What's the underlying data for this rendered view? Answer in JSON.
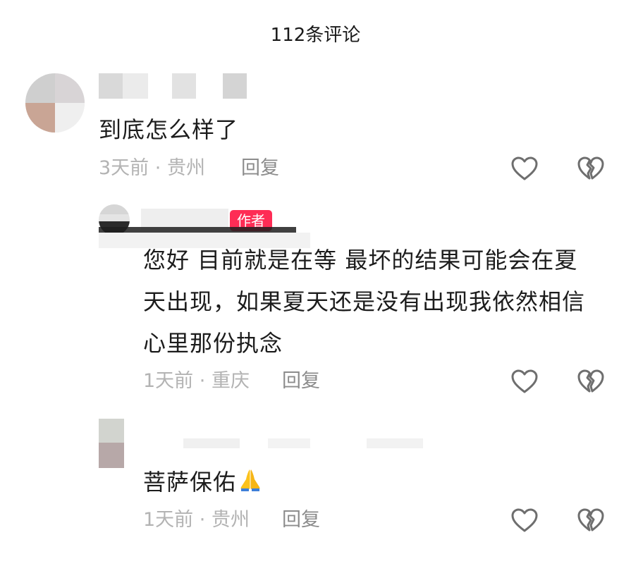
{
  "header": {
    "title": "112条评论"
  },
  "comments": [
    {
      "text": "到底怎么样了",
      "time": "3天前",
      "location": "贵州",
      "reply_label": "回复"
    },
    {
      "badge": "作者",
      "text_lines": [
        "您好  目前就是在等  最坏的结果可能会在夏",
        "天出现，如果夏天还是没有出现我依然相信",
        "心里那份执念"
      ],
      "time": "1天前",
      "location": "重庆",
      "reply_label": "回复"
    },
    {
      "text": "菩萨保佑",
      "time": "1天前",
      "location": "贵州",
      "reply_label": "回复"
    }
  ],
  "icons": {
    "like": "heart-outline-icon",
    "dislike": "broken-heart-icon",
    "emoji": "folded-hands-emoji"
  },
  "colors": {
    "badge": "#fe2c55",
    "meta": "#b3b3b3",
    "reply": "#8c8c8c",
    "icon": "#6e6e6e"
  }
}
